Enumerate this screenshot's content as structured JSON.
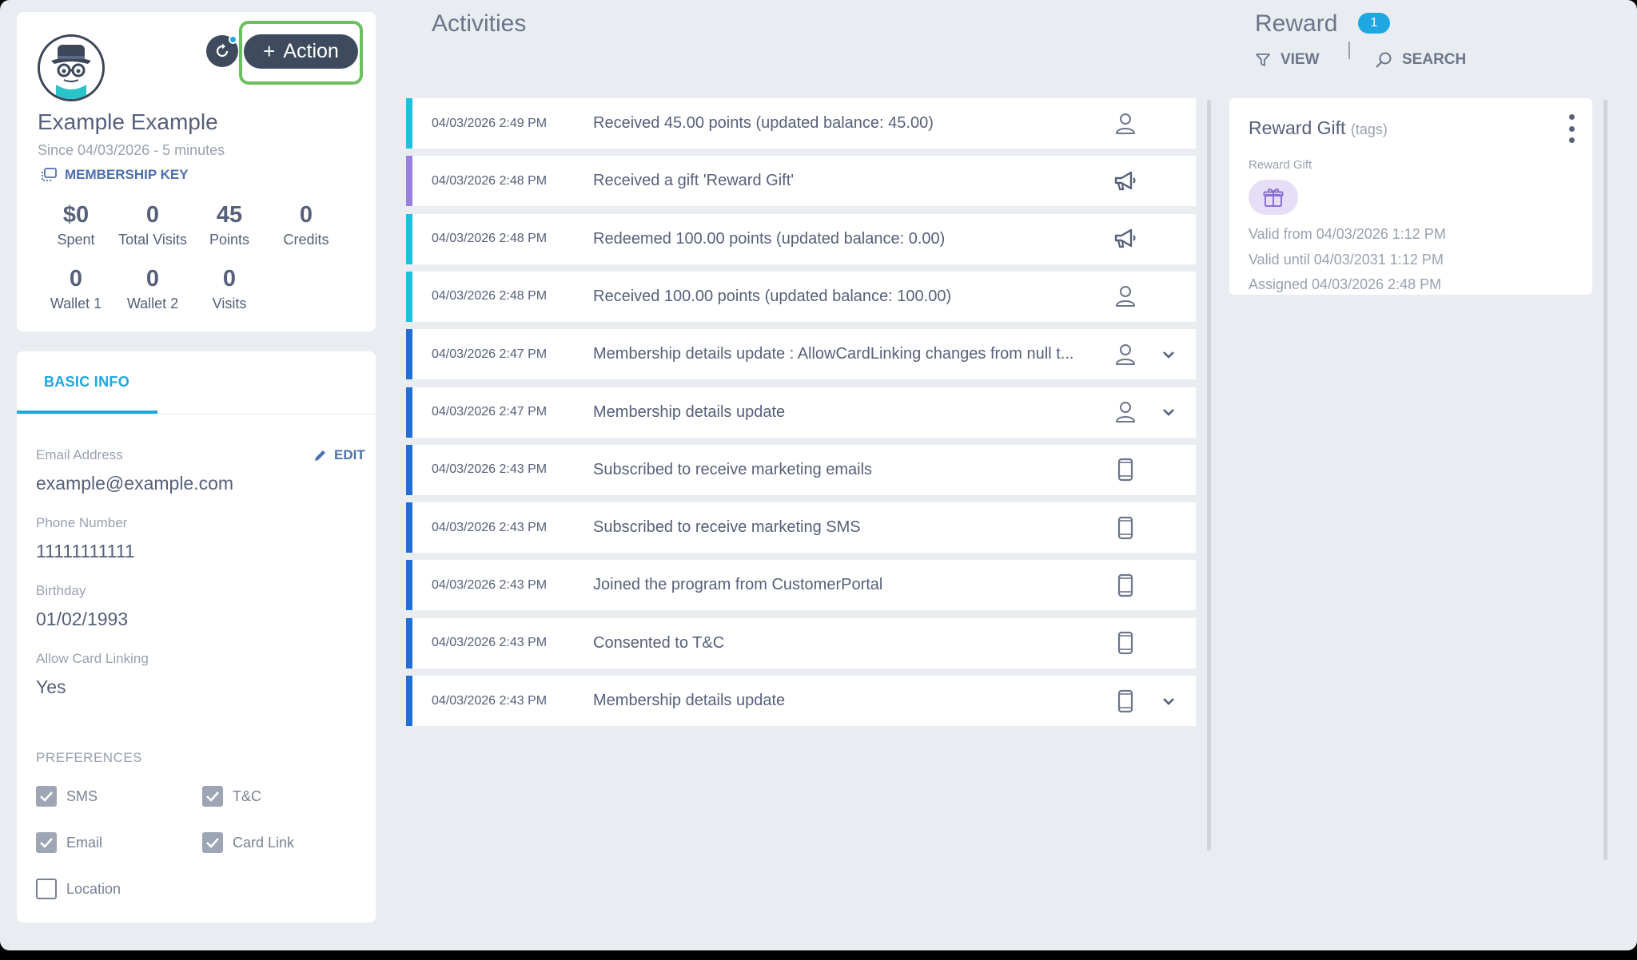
{
  "profile": {
    "name": "Example Example",
    "since": "Since 04/03/2026 - 5 minutes",
    "membership_key": "MEMBERSHIP KEY",
    "action_label": "Action",
    "stats": [
      {
        "value": "$0",
        "label": "Spent"
      },
      {
        "value": "0",
        "label": "Total Visits"
      },
      {
        "value": "45",
        "label": "Points"
      },
      {
        "value": "0",
        "label": "Credits"
      },
      {
        "value": "0",
        "label": "Wallet 1"
      },
      {
        "value": "0",
        "label": "Wallet 2"
      },
      {
        "value": "0",
        "label": "Visits"
      }
    ]
  },
  "basic_info": {
    "tab": "BASIC INFO",
    "edit": "EDIT",
    "fields": [
      {
        "label": "Email Address",
        "value": "example@example.com"
      },
      {
        "label": "Phone Number",
        "value": "11111111111"
      },
      {
        "label": "Birthday",
        "value": "01/02/1993"
      },
      {
        "label": "Allow Card Linking",
        "value": "Yes"
      }
    ],
    "preferences_title": "PREFERENCES",
    "preferences": [
      {
        "label": "SMS",
        "checked": true
      },
      {
        "label": "T&C",
        "checked": true
      },
      {
        "label": "Email",
        "checked": true
      },
      {
        "label": "Card Link",
        "checked": true
      },
      {
        "label": "Location",
        "checked": false
      }
    ]
  },
  "activities": {
    "title": "Activities",
    "items": [
      {
        "date": "04/03/2026 2:49 PM",
        "text": "Received 45.00 points (updated balance: 45.00)",
        "icon": "person-icon",
        "color": "#1ec0e0",
        "expand": false
      },
      {
        "date": "04/03/2026 2:48 PM",
        "text": "Received a gift 'Reward Gift'",
        "icon": "megaphone-icon",
        "color": "#9b7fe0",
        "expand": false
      },
      {
        "date": "04/03/2026 2:48 PM",
        "text": "Redeemed 100.00 points (updated balance: 0.00)",
        "icon": "megaphone-icon",
        "color": "#1ec0e0",
        "expand": false
      },
      {
        "date": "04/03/2026 2:48 PM",
        "text": "Received 100.00 points (updated balance: 100.00)",
        "icon": "person-icon",
        "color": "#1ec0e0",
        "expand": false
      },
      {
        "date": "04/03/2026 2:47 PM",
        "text": "Membership details update : AllowCardLinking changes from null t...",
        "icon": "person-icon",
        "color": "#1f6fd6",
        "expand": true
      },
      {
        "date": "04/03/2026 2:47 PM",
        "text": "Membership details update",
        "icon": "person-icon",
        "color": "#1f6fd6",
        "expand": true
      },
      {
        "date": "04/03/2026 2:43 PM",
        "text": "Subscribed to receive marketing emails",
        "icon": "mobile-icon",
        "color": "#1f6fd6",
        "expand": false
      },
      {
        "date": "04/03/2026 2:43 PM",
        "text": "Subscribed to receive marketing SMS",
        "icon": "mobile-icon",
        "color": "#1f6fd6",
        "expand": false
      },
      {
        "date": "04/03/2026 2:43 PM",
        "text": "Joined the program from CustomerPortal",
        "icon": "mobile-icon",
        "color": "#1f6fd6",
        "expand": false
      },
      {
        "date": "04/03/2026 2:43 PM",
        "text": "Consented to T&C",
        "icon": "mobile-icon",
        "color": "#1f6fd6",
        "expand": false
      },
      {
        "date": "04/03/2026 2:43 PM",
        "text": "Membership details update",
        "icon": "mobile-icon",
        "color": "#1f6fd6",
        "expand": true
      }
    ]
  },
  "reward": {
    "title": "Reward",
    "count": "1",
    "view_label": "VIEW",
    "search_label": "SEARCH",
    "card": {
      "title": "Reward Gift",
      "tags": "(tags)",
      "subtitle": "Reward Gift",
      "valid_from": "Valid from 04/03/2026 1:12 PM",
      "valid_until": "Valid until 04/03/2031 1:12 PM",
      "assigned": "Assigned 04/03/2026 2:48 PM"
    }
  }
}
